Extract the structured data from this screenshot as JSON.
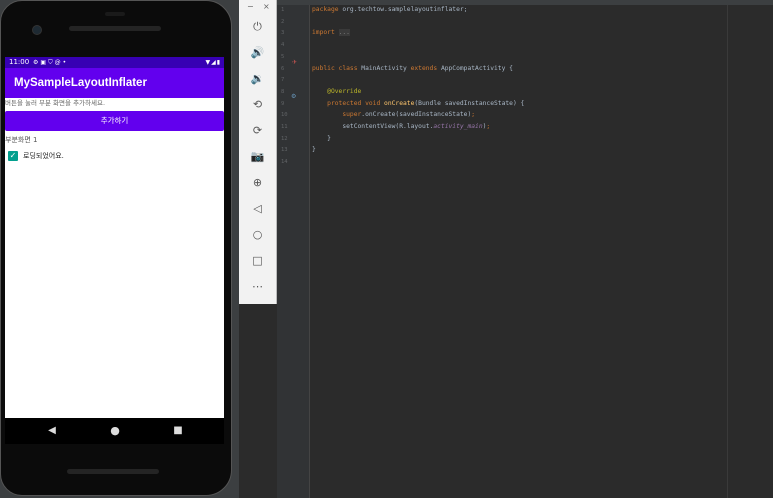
{
  "device": {
    "status_bar": {
      "time": "11:00",
      "icons": [
        "gear-icon",
        "sim-icon",
        "shield-icon",
        "at-icon",
        "dot-icon"
      ],
      "right_icons": [
        "wifi-icon",
        "signal-icon",
        "battery-icon"
      ]
    },
    "app_title": "MySampleLayoutInflater",
    "hint_text": "버튼을 눌러 부분 화면을 추가하세요.",
    "add_button_label": "추가하기",
    "sub_layout_label": "부분화면 1",
    "checkbox": {
      "label": "로딩되었어요.",
      "checked": true,
      "color": "#03a08e"
    },
    "nav": {
      "back": "◀",
      "home": "●",
      "recent": "■"
    },
    "colors": {
      "primary": "#6200ee",
      "primary_dark": "#3700b3"
    }
  },
  "emulator_toolbar": {
    "window_controls": {
      "minimize": "−",
      "close": "×"
    },
    "tools": [
      {
        "name": "power-icon",
        "glyph": "⏻"
      },
      {
        "name": "volume-up-icon",
        "glyph": "🔊"
      },
      {
        "name": "volume-down-icon",
        "glyph": "🔉"
      },
      {
        "name": "rotate-left-icon",
        "glyph": "⟲"
      },
      {
        "name": "rotate-right-icon",
        "glyph": "⟳"
      },
      {
        "name": "camera-icon",
        "glyph": "📷"
      },
      {
        "name": "zoom-icon",
        "glyph": "⊕"
      },
      {
        "name": "back-icon",
        "glyph": "◁"
      },
      {
        "name": "home-icon",
        "glyph": "○"
      },
      {
        "name": "overview-icon",
        "glyph": "□"
      },
      {
        "name": "more-icon",
        "glyph": "⋯"
      }
    ]
  },
  "editor": {
    "line_numbers": [
      "1",
      "2",
      "3",
      "4",
      "5",
      "6",
      "7",
      "8",
      "9",
      "10",
      "11",
      "12",
      "13",
      "14"
    ],
    "lines": [
      [
        {
          "t": "package ",
          "c": "kw"
        },
        {
          "t": "org.techtow.samplelayoutinflater;",
          "c": ""
        }
      ],
      [],
      [
        {
          "t": "import ",
          "c": "kw"
        },
        {
          "t": "...",
          "c": "fold"
        }
      ],
      [],
      [],
      [
        {
          "t": "public class ",
          "c": "kw"
        },
        {
          "t": "MainActivity ",
          "c": ""
        },
        {
          "t": "extends ",
          "c": "kw"
        },
        {
          "t": "AppCompatActivity {",
          "c": ""
        }
      ],
      [],
      [
        {
          "t": "    @Override",
          "c": "an"
        }
      ],
      [
        {
          "t": "    protected void ",
          "c": "kw"
        },
        {
          "t": "onCreate",
          "c": "fn"
        },
        {
          "t": "(Bundle savedInstanceState) {",
          "c": ""
        }
      ],
      [
        {
          "t": "        super",
          "c": "kw"
        },
        {
          "t": ".onCreate(savedInstanceState)",
          "c": ""
        },
        {
          "t": ";",
          "c": "kw"
        }
      ],
      [
        {
          "t": "        setContentView(R.layout.",
          "c": ""
        },
        {
          "t": "activity_main",
          "c": "fd"
        },
        {
          "t": ")",
          "c": ""
        },
        {
          "t": ";",
          "c": "kw"
        }
      ],
      [
        {
          "t": "    }",
          "c": ""
        }
      ],
      [
        {
          "t": "}",
          "c": ""
        }
      ],
      []
    ]
  }
}
